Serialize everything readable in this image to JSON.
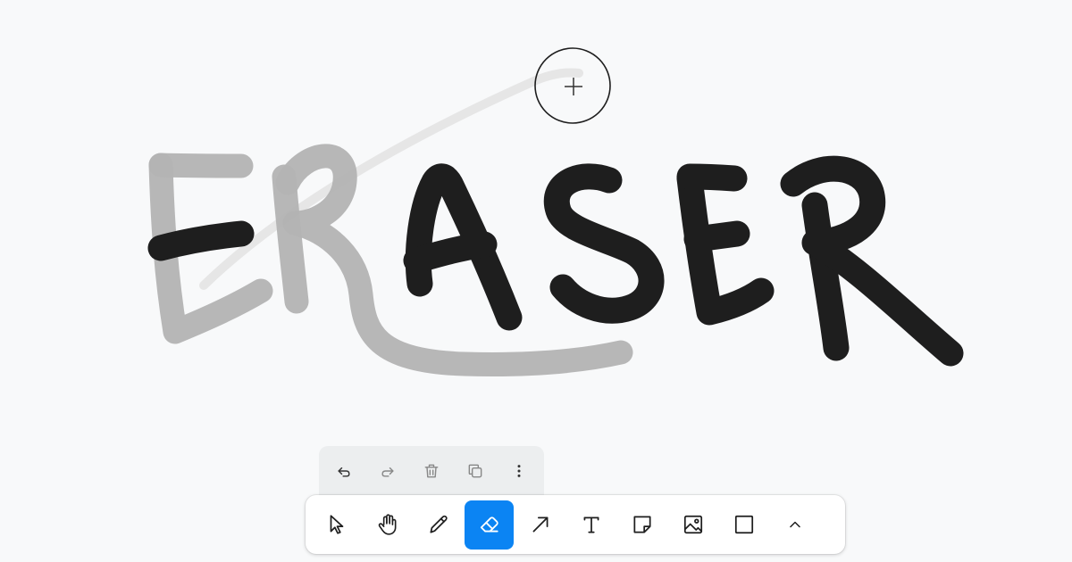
{
  "app": {
    "canvas_background": "#f8f9fa",
    "ink_color": "#1e1e1e",
    "faded_ink_color": "#b2b2b2",
    "accent": "#0b84f3"
  },
  "canvas": {
    "drawn_word": "ERASER",
    "cursor": "eraser-crosshair-cursor"
  },
  "actions_bar": {
    "items": [
      {
        "name": "undo",
        "icon": "undo-icon"
      },
      {
        "name": "redo",
        "icon": "redo-icon"
      },
      {
        "name": "delete",
        "icon": "trash-icon"
      },
      {
        "name": "duplicate",
        "icon": "duplicate-icon"
      },
      {
        "name": "more",
        "icon": "more-vertical-icon"
      }
    ]
  },
  "toolbar": {
    "active_tool": "eraser",
    "tools": [
      {
        "name": "select",
        "icon": "cursor-icon"
      },
      {
        "name": "hand",
        "icon": "hand-icon"
      },
      {
        "name": "draw",
        "icon": "pencil-icon"
      },
      {
        "name": "eraser",
        "icon": "eraser-icon"
      },
      {
        "name": "arrow",
        "icon": "arrow-icon"
      },
      {
        "name": "text",
        "icon": "text-icon"
      },
      {
        "name": "note",
        "icon": "sticky-note-icon"
      },
      {
        "name": "asset",
        "icon": "image-icon"
      },
      {
        "name": "rectangle",
        "icon": "rectangle-icon"
      },
      {
        "name": "more",
        "icon": "chevron-up-icon"
      }
    ]
  }
}
